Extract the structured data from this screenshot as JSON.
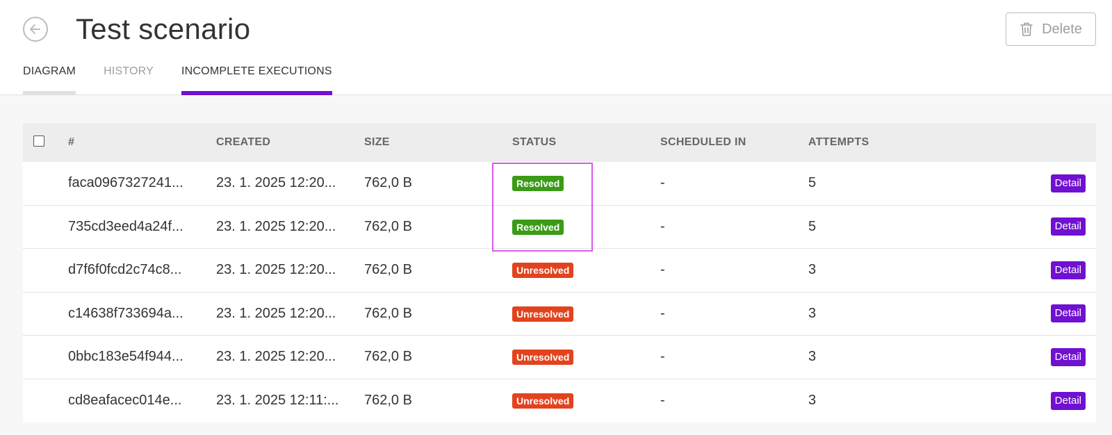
{
  "header": {
    "title": "Test scenario",
    "delete_label": "Delete"
  },
  "tabs": [
    {
      "label": "DIAGRAM"
    },
    {
      "label": "HISTORY"
    },
    {
      "label": "INCOMPLETE EXECUTIONS"
    }
  ],
  "table": {
    "columns": [
      "#",
      "CREATED",
      "SIZE",
      "STATUS",
      "SCHEDULED IN",
      "ATTEMPTS"
    ],
    "detail_label": "Detail",
    "rows": [
      {
        "id": "faca0967327241...",
        "created": "23. 1. 2025 12:20...",
        "size": "762,0 B",
        "status": "Resolved",
        "scheduled": "-",
        "attempts": "5"
      },
      {
        "id": "735cd3eed4a24f...",
        "created": "23. 1. 2025 12:20...",
        "size": "762,0 B",
        "status": "Resolved",
        "scheduled": "-",
        "attempts": "5"
      },
      {
        "id": "d7f6f0fcd2c74c8...",
        "created": "23. 1. 2025 12:20...",
        "size": "762,0 B",
        "status": "Unresolved",
        "scheduled": "-",
        "attempts": "3"
      },
      {
        "id": "c14638f733694a...",
        "created": "23. 1. 2025 12:20...",
        "size": "762,0 B",
        "status": "Unresolved",
        "scheduled": "-",
        "attempts": "3"
      },
      {
        "id": "0bbc183e54f944...",
        "created": "23. 1. 2025 12:20...",
        "size": "762,0 B",
        "status": "Unresolved",
        "scheduled": "-",
        "attempts": "3"
      },
      {
        "id": "cd8eafacec014e...",
        "created": "23. 1. 2025 12:11:...",
        "size": "762,0 B",
        "status": "Unresolved",
        "scheduled": "-",
        "attempts": "3"
      }
    ]
  },
  "colors": {
    "accent": "#7010d0",
    "resolved": "#3a9b16",
    "unresolved": "#e2431e",
    "highlight": "#d65bf0"
  },
  "icons": {
    "back": "arrow-left-icon",
    "delete": "trash-icon"
  }
}
